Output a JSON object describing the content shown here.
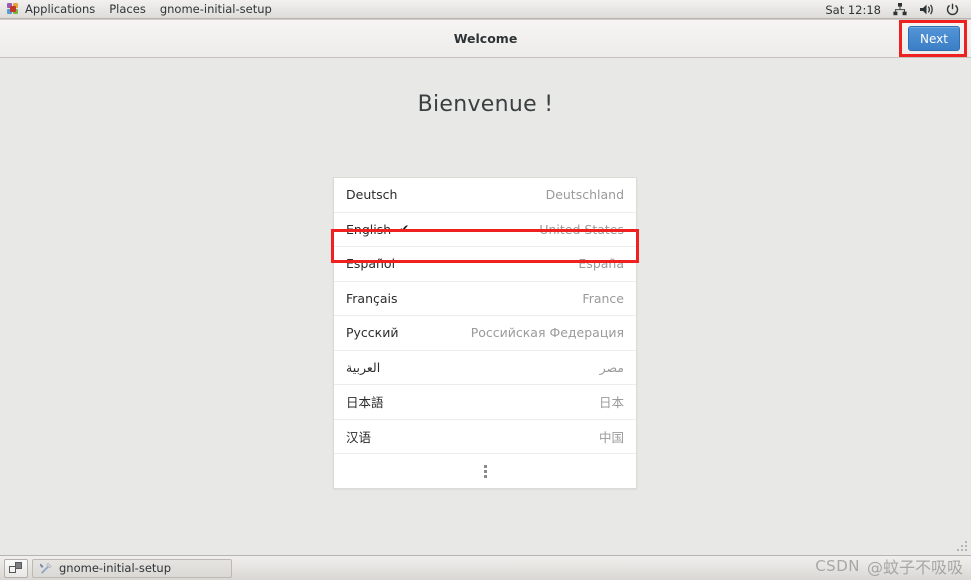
{
  "top_panel": {
    "applications_label": "Applications",
    "places_label": "Places",
    "window_menu_label": "gnome-initial-setup",
    "clock": "Sat 12:18",
    "icons": {
      "applications": "applications-pinwheel-icon",
      "network": "network-icon",
      "volume": "volume-icon",
      "power": "power-icon"
    }
  },
  "window": {
    "title": "Welcome",
    "next_label": "Next",
    "heading": "Bienvenue !"
  },
  "language_list": {
    "rows": [
      {
        "language": "Deutsch",
        "country": "Deutschland",
        "selected": false,
        "rtl": false
      },
      {
        "language": "English",
        "country": "United States",
        "selected": true,
        "rtl": false
      },
      {
        "language": "Español",
        "country": "España",
        "selected": false,
        "rtl": false
      },
      {
        "language": "Français",
        "country": "France",
        "selected": false,
        "rtl": false
      },
      {
        "language": "Русский",
        "country": "Российская Федерация",
        "selected": false,
        "rtl": false
      },
      {
        "language": "العربية",
        "country": "مصر",
        "selected": false,
        "rtl": true
      },
      {
        "language": "日本語",
        "country": "日本",
        "selected": false,
        "rtl": false
      },
      {
        "language": "汉语",
        "country": "中国",
        "selected": false,
        "rtl": false
      }
    ],
    "check_glyph": "✔",
    "more_indicator": "more-options-icon"
  },
  "taskbar": {
    "workspace_switcher": "workspace-switcher-icon",
    "window_button_label": "gnome-initial-setup"
  },
  "watermark": {
    "brand": "CSDN",
    "user": "@蚊子不吸吸"
  },
  "annotations": {
    "next_button_highlight_color": "#ee2020",
    "english_row_highlight_color": "#ee2020"
  },
  "colors": {
    "accent_button": "#3d7fc6",
    "page_background": "#e8e8e6",
    "list_background": "#ffffff",
    "country_text": "#9a9a9a"
  }
}
